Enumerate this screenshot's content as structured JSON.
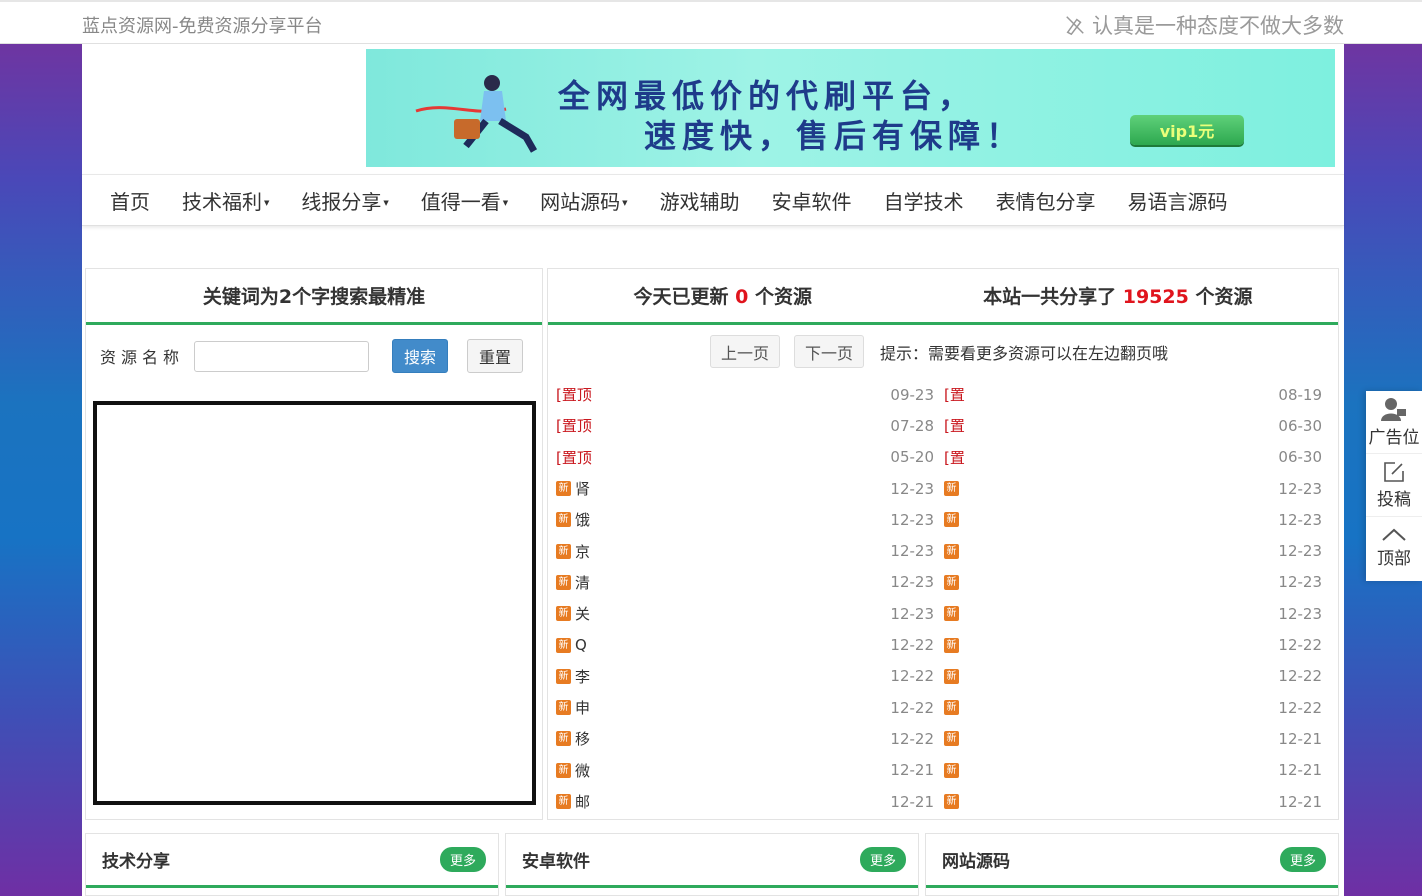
{
  "topbar": {
    "site_title": "蓝点资源网-免费资源分享平台",
    "motto": "认真是一种态度不做大多数"
  },
  "banner": {
    "line1": "全网最低价的代刷平台，",
    "line2": "速度快，售后有保障！",
    "vip": "vip1元"
  },
  "nav": [
    {
      "label": "首页",
      "dropdown": false
    },
    {
      "label": "技术福利",
      "dropdown": true
    },
    {
      "label": "线报分享",
      "dropdown": true
    },
    {
      "label": "值得一看",
      "dropdown": true
    },
    {
      "label": "网站源码",
      "dropdown": true
    },
    {
      "label": "游戏辅助",
      "dropdown": false
    },
    {
      "label": "安卓软件",
      "dropdown": false
    },
    {
      "label": "自学技术",
      "dropdown": false
    },
    {
      "label": "表情包分享",
      "dropdown": false
    },
    {
      "label": "易语言源码",
      "dropdown": false
    }
  ],
  "search_panel": {
    "heading": "关键词为2个字搜索最精准",
    "label": "资源名称",
    "input_value": "",
    "search_button": "搜索",
    "reset_button": "重置"
  },
  "resource_panel": {
    "today_prefix": "今天已更新",
    "today_count": "0",
    "today_suffix": "个资源",
    "total_prefix": "本站一共分享了",
    "total_count": "19525",
    "total_suffix": "个资源",
    "prev_button": "上一页",
    "next_button": "下一页",
    "hint": "提示：需要看更多资源可以在左边翻页哦",
    "left_items": [
      {
        "type": "top",
        "title": "[置顶",
        "date": "09-23"
      },
      {
        "type": "top",
        "title": "[置顶",
        "date": "07-28"
      },
      {
        "type": "top",
        "title": "[置顶",
        "date": "05-20"
      },
      {
        "type": "new",
        "title": "肾",
        "date": "12-23"
      },
      {
        "type": "new",
        "title": "饿",
        "date": "12-23"
      },
      {
        "type": "new",
        "title": "京",
        "date": "12-23"
      },
      {
        "type": "new",
        "title": "清",
        "date": "12-23"
      },
      {
        "type": "new",
        "title": "关",
        "date": "12-23"
      },
      {
        "type": "new",
        "title": "Q",
        "date": "12-22"
      },
      {
        "type": "new",
        "title": "李",
        "date": "12-22"
      },
      {
        "type": "new",
        "title": "申",
        "date": "12-22"
      },
      {
        "type": "new",
        "title": "移",
        "date": "12-22"
      },
      {
        "type": "new",
        "title": "微",
        "date": "12-21"
      },
      {
        "type": "new",
        "title": "邮",
        "date": "12-21"
      }
    ],
    "right_items": [
      {
        "type": "top",
        "title": "[置",
        "date": "08-19"
      },
      {
        "type": "top",
        "title": "[置",
        "date": "06-30"
      },
      {
        "type": "top",
        "title": "[置",
        "date": "06-30"
      },
      {
        "type": "new",
        "title": "",
        "date": "12-23"
      },
      {
        "type": "new",
        "title": "",
        "date": "12-23"
      },
      {
        "type": "new",
        "title": "",
        "date": "12-23"
      },
      {
        "type": "new",
        "title": "",
        "date": "12-23"
      },
      {
        "type": "new",
        "title": "",
        "date": "12-23"
      },
      {
        "type": "new",
        "title": "",
        "date": "12-22"
      },
      {
        "type": "new",
        "title": "",
        "date": "12-22"
      },
      {
        "type": "new",
        "title": "",
        "date": "12-22"
      },
      {
        "type": "new",
        "title": "",
        "date": "12-21"
      },
      {
        "type": "new",
        "title": "",
        "date": "12-21"
      },
      {
        "type": "new",
        "title": "",
        "date": "12-21"
      }
    ],
    "new_badge": "新"
  },
  "bottom_sections": [
    {
      "title": "技术分享",
      "more": "更多"
    },
    {
      "title": "安卓软件",
      "more": "更多"
    },
    {
      "title": "网站源码",
      "more": "更多"
    }
  ],
  "side_float": {
    "ad": "广告位",
    "submit": "投稿",
    "top": "顶部"
  }
}
